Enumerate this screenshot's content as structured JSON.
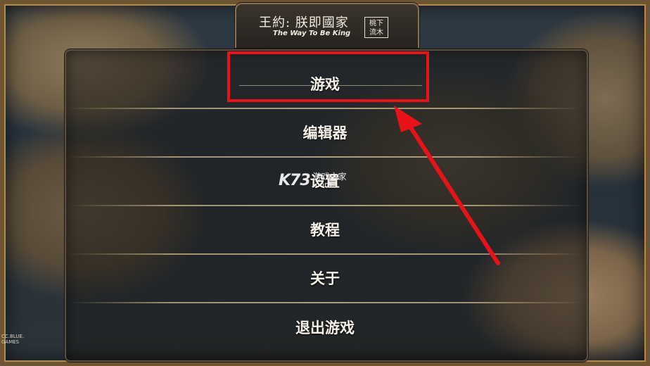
{
  "header": {
    "title": "王約: 朕即國家",
    "subtitle": "The Way To Be King",
    "seal_line1": "桃下",
    "seal_line2": "流木"
  },
  "menu": {
    "items": [
      {
        "label": "游戏"
      },
      {
        "label": "编辑器"
      },
      {
        "label": "设置"
      },
      {
        "label": "教程"
      },
      {
        "label": "关于"
      },
      {
        "label": "退出游戏"
      }
    ]
  },
  "annotation": {
    "highlight_color": "#e8121a",
    "arrow_color": "#e8121a"
  },
  "watermark": {
    "logo": "K73",
    "name": "游戏之家",
    "domain": ".com"
  },
  "corner_logo": {
    "line1": "CC.BLUE.",
    "line2": "GAMES"
  }
}
